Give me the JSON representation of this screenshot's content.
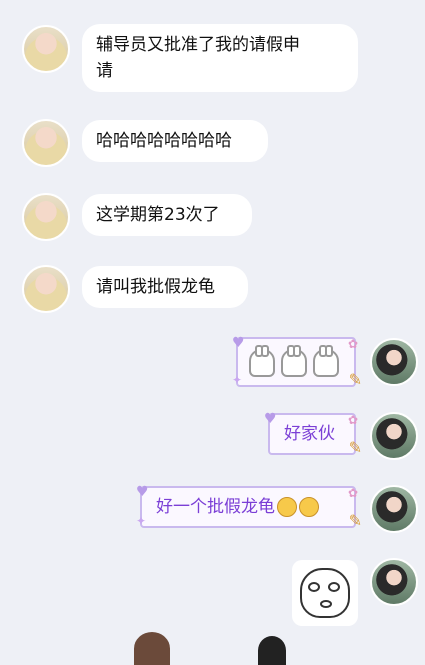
{
  "messages_left": [
    {
      "lines": [
        "辅导员又批准了我的请假申",
        "请"
      ]
    },
    {
      "lines": [
        "哈哈哈哈哈哈哈哈"
      ]
    },
    {
      "lines": [
        "这学期第23次了"
      ]
    },
    {
      "lines": [
        "请叫我批假龙龟"
      ]
    }
  ],
  "messages_right": [
    {
      "type": "sticker",
      "sticker": "alpaca-row"
    },
    {
      "type": "fancy-text",
      "text": "好家伙"
    },
    {
      "type": "fancy-text",
      "text": "好一个批假龙龟"
    },
    {
      "type": "meme",
      "sticker": "shocked-face"
    }
  ],
  "colors": {
    "background": "#eef0f6",
    "bubble_left": "#ffffff",
    "fancy_text": "#7b3fd6",
    "fancy_border": "#c9b9ee"
  }
}
